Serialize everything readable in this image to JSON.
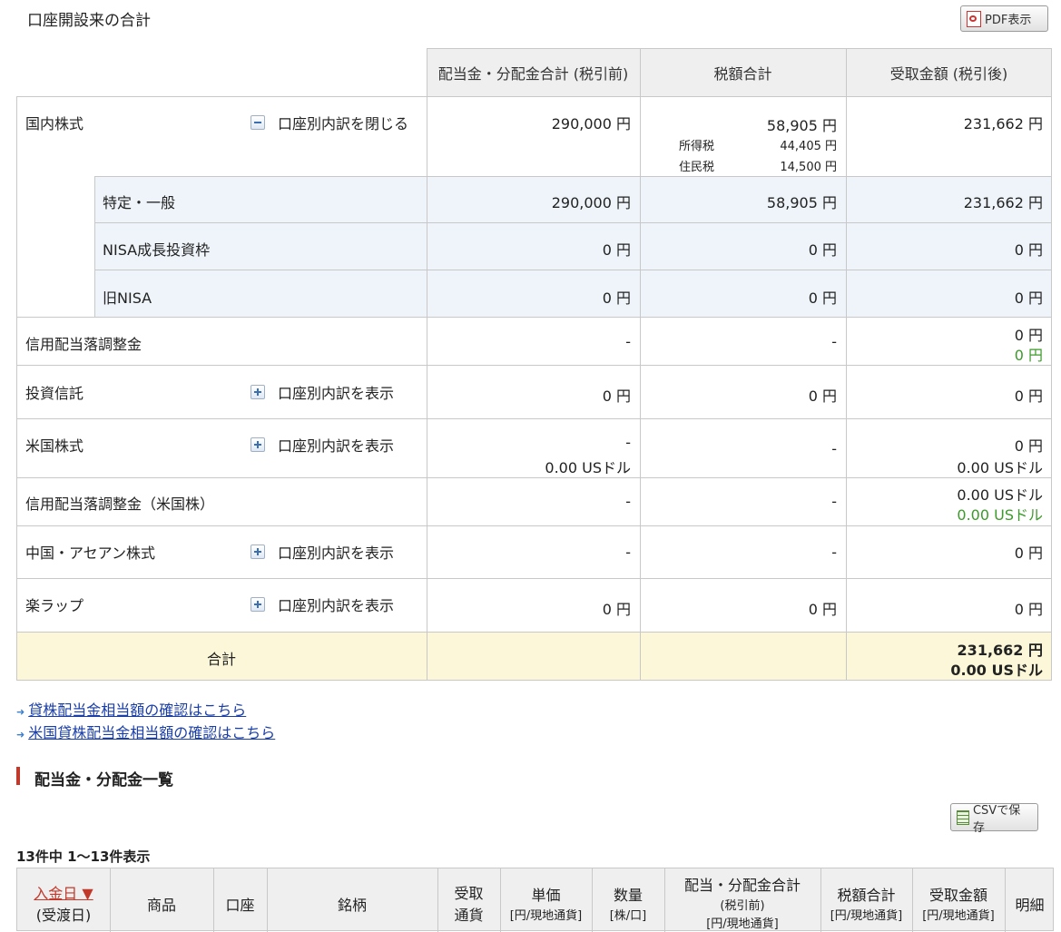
{
  "title": "口座開設来の合計",
  "pdf_button": "PDF表示",
  "headers": [
    "配当金・分配金合計 (税引前)",
    "税額合計",
    "受取金額 (税引後)"
  ],
  "domestic": {
    "label": "国内株式",
    "toggle": "口座別内訳を閉じる",
    "pretax": "290,000 円",
    "tax": "58,905 円",
    "tax_income_label": "所得税",
    "tax_income": "44,405 円",
    "tax_resident_label": "住民税",
    "tax_resident": "14,500 円",
    "received": "231,662 円",
    "sub": [
      {
        "label": "特定・一般",
        "pretax": "290,000 円",
        "tax": "58,905 円",
        "received": "231,662 円"
      },
      {
        "label": "NISA成長投資枠",
        "pretax": "0 円",
        "tax": "0 円",
        "received": "0 円"
      },
      {
        "label": "旧NISA",
        "pretax": "0 円",
        "tax": "0 円",
        "received": "0 円"
      }
    ]
  },
  "rows": [
    {
      "label": "信用配当落調整金",
      "toggle": "",
      "pretax": "-",
      "pretax2": "",
      "tax": "-",
      "received": "0 円",
      "received2": "0 円"
    },
    {
      "label": "投資信託",
      "toggle": "口座別内訳を表示",
      "pretax": "0 円",
      "pretax2": "",
      "tax": "0 円",
      "received": "0 円",
      "received2": ""
    },
    {
      "label": "米国株式",
      "toggle": "口座別内訳を表示",
      "pretax": "-",
      "pretax2": "0.00 USドル",
      "tax": "-",
      "received": "0 円",
      "received2": "0.00 USドル"
    },
    {
      "label": "信用配当落調整金（米国株）",
      "toggle": "",
      "pretax": "-",
      "pretax2": "",
      "tax": "-",
      "received": "0.00 USドル",
      "received2": "0.00 USドル"
    },
    {
      "label": "中国・アセアン株式",
      "toggle": "口座別内訳を表示",
      "pretax": "-",
      "pretax2": "",
      "tax": "-",
      "received": "0 円",
      "received2": ""
    },
    {
      "label": "楽ラップ",
      "toggle": "口座別内訳を表示",
      "pretax": "0 円",
      "pretax2": "",
      "tax": "0 円",
      "received": "0 円",
      "received2": ""
    }
  ],
  "total": {
    "label": "合計",
    "received": "231,662 円",
    "received2": "0.00 USドル"
  },
  "links": [
    "貸株配当金相当額の確認はこちら",
    "米国貸株配当金相当額の確認はこちら"
  ],
  "section_title": "配当金・分配金一覧",
  "csv_button": "CSVで保存",
  "count_text": "13件中 1〜13件表示",
  "list_headers": {
    "date": "入金日 ▼",
    "date_sub": "(受渡日)",
    "product": "商品",
    "account": "口座",
    "name": "銘柄",
    "currency": "受取",
    "currency2": "通貨",
    "unit": "単価",
    "unit_sub": "[円/現地通貨]",
    "qty": "数量",
    "qty_sub": "[株/口]",
    "pretax": "配当・分配金合計",
    "pretax_sub": "(税引前)",
    "pretax_sub2": "[円/現地通貨]",
    "tax": "税額合計",
    "tax_sub": "[円/現地通貨]",
    "received": "受取金額",
    "received_sub": "[円/現地通貨]",
    "detail": "明細"
  },
  "colors": {
    "accent": "#c0392b",
    "total_bg": "#fbf7d8",
    "sub_bg": "#eef4f9",
    "green": "#3c9a2a"
  }
}
